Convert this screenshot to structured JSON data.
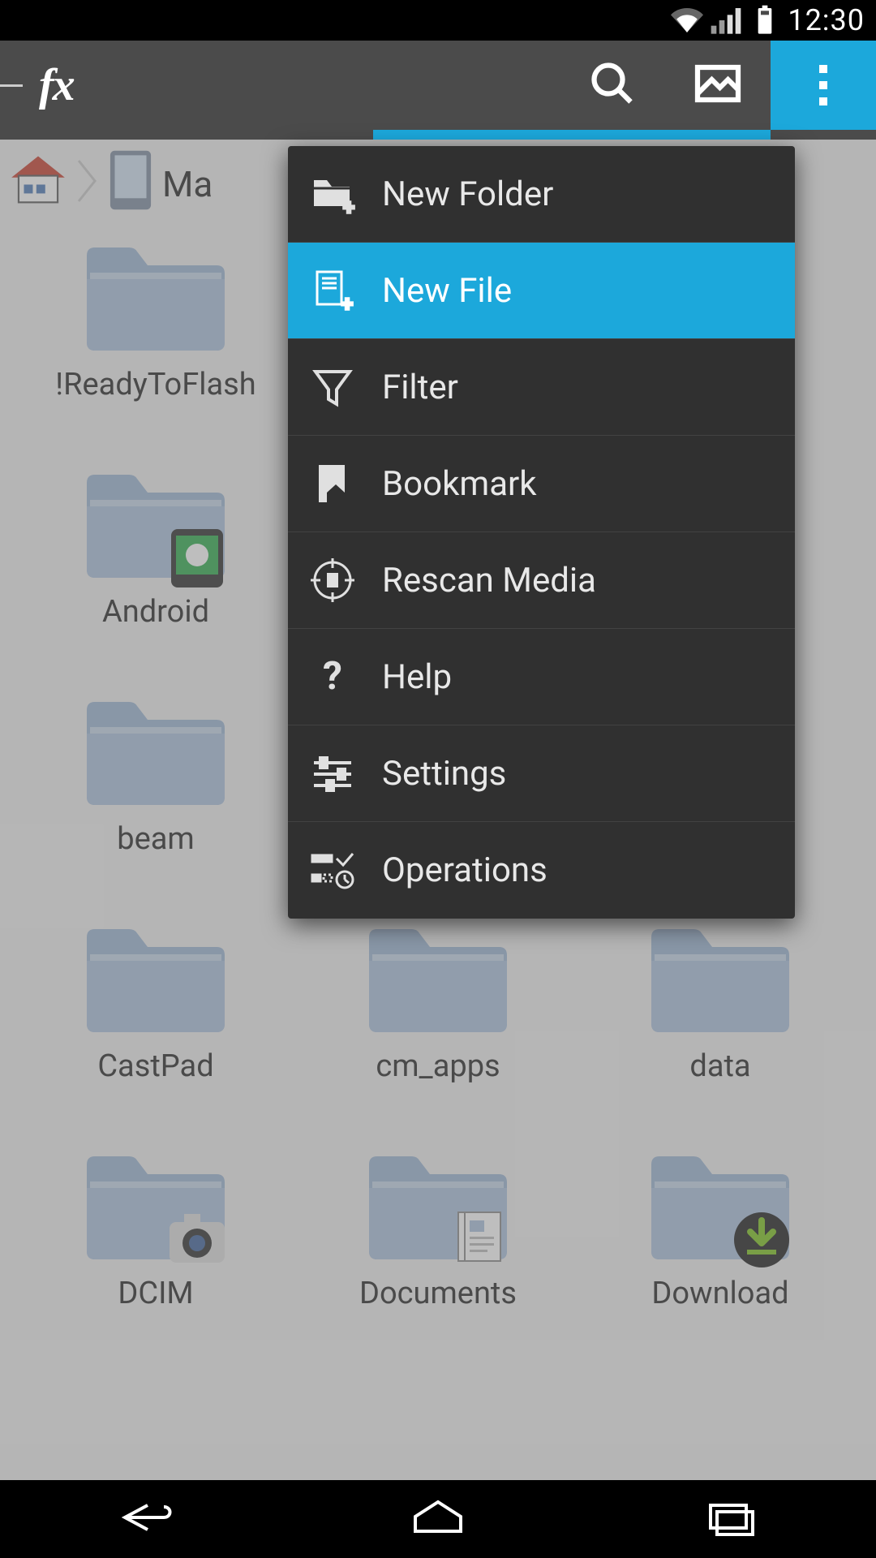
{
  "status_bar": {
    "time": "12:30"
  },
  "action_bar": {
    "logo_text": "fx"
  },
  "breadcrumb": {
    "current_label": "Ma"
  },
  "grid_items": [
    {
      "label": "!ReadyToFlash",
      "badge": "none"
    },
    {
      "label": "",
      "badge": "none"
    },
    {
      "label": "",
      "badge": "none"
    },
    {
      "label": "Android",
      "badge": "android"
    },
    {
      "label": "",
      "badge": "none"
    },
    {
      "label": "",
      "badge": "none"
    },
    {
      "label": "beam",
      "badge": "none"
    },
    {
      "label": "",
      "badge": "none"
    },
    {
      "label": "",
      "badge": "none"
    },
    {
      "label": "CastPad",
      "badge": "none"
    },
    {
      "label": "cm_apps",
      "badge": "none"
    },
    {
      "label": "data",
      "badge": "none"
    },
    {
      "label": "DCIM",
      "badge": "camera"
    },
    {
      "label": "Documents",
      "badge": "document"
    },
    {
      "label": "Download",
      "badge": "download"
    }
  ],
  "menu": {
    "items": [
      {
        "label": "New Folder",
        "icon": "folder-plus-icon",
        "selected": false
      },
      {
        "label": "New File",
        "icon": "file-plus-icon",
        "selected": true
      },
      {
        "label": "Filter",
        "icon": "funnel-icon",
        "selected": false
      },
      {
        "label": "Bookmark",
        "icon": "bookmark-icon",
        "selected": false
      },
      {
        "label": "Rescan Media",
        "icon": "rescan-media-icon",
        "selected": false
      },
      {
        "label": "Help",
        "icon": "help-icon",
        "selected": false
      },
      {
        "label": "Settings",
        "icon": "settings-sliders-icon",
        "selected": false
      },
      {
        "label": "Operations",
        "icon": "operations-icon",
        "selected": false
      }
    ]
  },
  "colors": {
    "accent": "#1ca8db"
  }
}
